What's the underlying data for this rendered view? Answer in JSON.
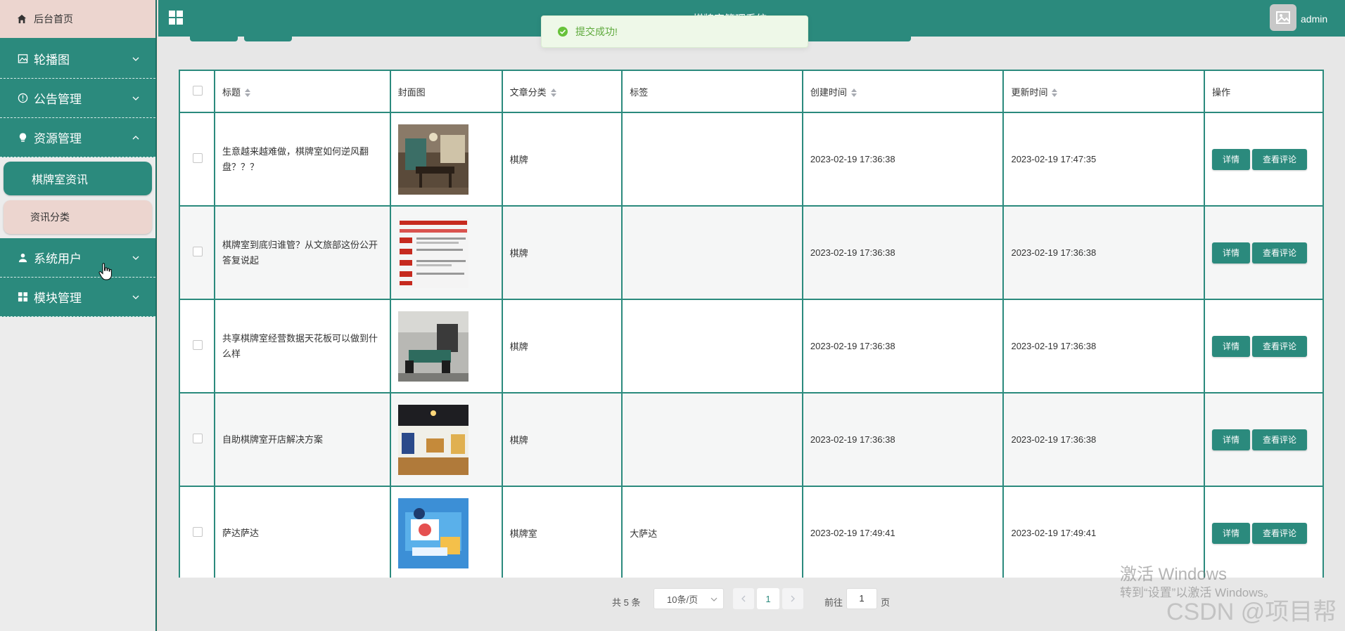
{
  "app": {
    "title": "棋牌室管理系统",
    "user": "admin"
  },
  "sidebar": {
    "home": "后台首页",
    "menus": [
      {
        "label": "轮播图",
        "icon": "image-icon",
        "state": "collapsed"
      },
      {
        "label": "公告管理",
        "icon": "info-circle-icon",
        "state": "collapsed"
      },
      {
        "label": "资源管理",
        "icon": "bulb-icon",
        "state": "expanded"
      },
      {
        "label": "系统用户",
        "icon": "user-icon",
        "state": "collapsed"
      },
      {
        "label": "模块管理",
        "icon": "grid-icon",
        "state": "collapsed"
      }
    ],
    "submenu": {
      "active": "棋牌室资讯",
      "other": "资讯分类"
    }
  },
  "toast": {
    "message": "提交成功!"
  },
  "table": {
    "headers": {
      "title": "标题",
      "cover": "封面图",
      "category": "文章分类",
      "tags": "标签",
      "created": "创建时间",
      "updated": "更新时间",
      "actions": "操作"
    },
    "rows": [
      {
        "title": "生意越来越难做，棋牌室如何逆风翻盘？？？",
        "category": "棋牌",
        "tags": "",
        "created": "2023-02-19 17:36:38",
        "updated": "2023-02-19 17:47:35",
        "thumb": "room-photo"
      },
      {
        "title": "棋牌室到底归谁管？从文旅部这份公开答复说起",
        "category": "棋牌",
        "tags": "",
        "created": "2023-02-19 17:36:38",
        "updated": "2023-02-19 17:36:38",
        "thumb": "document-photo"
      },
      {
        "title": "共享棋牌室经营数据天花板可以做到什么样",
        "category": "棋牌",
        "tags": "",
        "created": "2023-02-19 17:36:38",
        "updated": "2023-02-19 17:36:38",
        "thumb": "room-photo-2"
      },
      {
        "title": "自助棋牌室开店解决方案",
        "category": "棋牌",
        "tags": "",
        "created": "2023-02-19 17:36:38",
        "updated": "2023-02-19 17:36:38",
        "thumb": "shop-photo"
      },
      {
        "title": "萨达萨达",
        "category": "棋牌室",
        "tags": "大萨达",
        "created": "2023-02-19 17:49:41",
        "updated": "2023-02-19 17:49:41",
        "thumb": "illustration"
      }
    ],
    "buttons": {
      "detail": "详情",
      "comments": "查看评论"
    }
  },
  "pagination": {
    "total": "共 5 条",
    "page_size": "10条/页",
    "current": "1",
    "goto_label": "前往",
    "goto_value": "1",
    "page_unit": "页"
  },
  "watermark": {
    "line1": "激活 Windows",
    "line2": "转到“设置”以激活 Windows。",
    "csdn": "CSDN @项目帮"
  },
  "colors": {
    "primary": "#2b8a7d",
    "header": "#2b8a7d",
    "sidebar_home": "#ecd5cf",
    "success": "#5da93b"
  }
}
